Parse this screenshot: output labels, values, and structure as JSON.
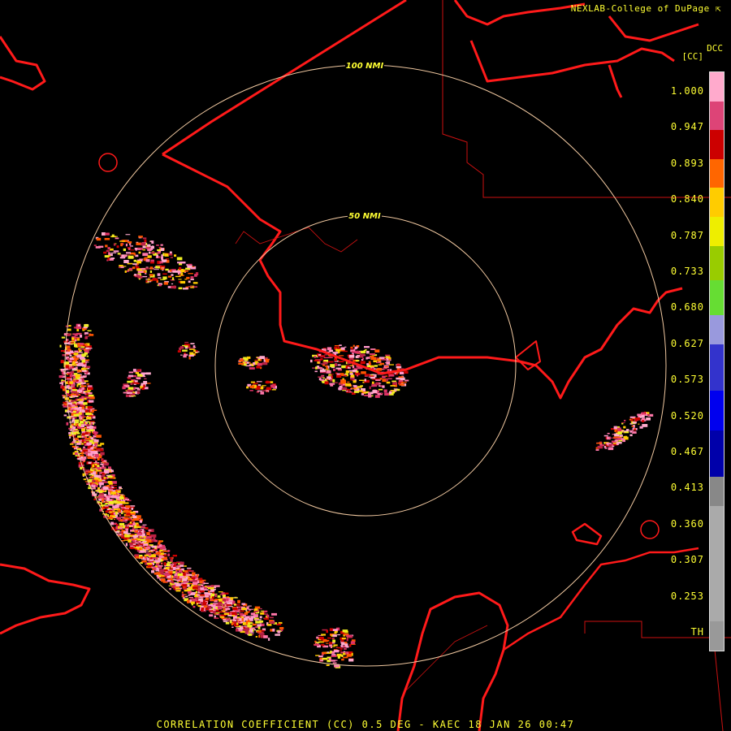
{
  "header": {
    "credit": "NEXLAB-College of DuPage",
    "credit_icon": "nexlab-logo-icon",
    "product_code": "DCC",
    "units": "[CC]"
  },
  "footer": {
    "title": "CORRELATION COEFFICIENT (CC) 0.5 DEG - KAEC 18 JAN 26 00:47"
  },
  "range_rings": [
    {
      "label": "50 NMI"
    },
    {
      "label": "100 NMI"
    }
  ],
  "legend": {
    "labels": [
      "1.000",
      "0.947",
      "0.893",
      "0.840",
      "0.787",
      "0.733",
      "0.680",
      "0.627",
      "0.573",
      "0.520",
      "0.467",
      "0.413",
      "0.360",
      "0.307",
      "0.253",
      "TH"
    ],
    "colors": [
      "#ffaacc",
      "#dd4477",
      "#cc0000",
      "#ff6600",
      "#ffcc00",
      "#eeee00",
      "#99cc00",
      "#66dd33",
      "#9999dd",
      "#3333cc",
      "#0000ee",
      "#0000aa",
      "#888888",
      "#aaaaaa",
      "#999999",
      "#000000"
    ],
    "color_stops": [
      0.0,
      0.05,
      0.1,
      0.15,
      0.2,
      0.25,
      0.3,
      0.36,
      0.42,
      0.47,
      0.55,
      0.62,
      0.7,
      0.75,
      0.95,
      1.0
    ]
  },
  "colors": {
    "coastline": "#ff1a1a",
    "rings": "#f0c8a0",
    "text": "#ffff33"
  }
}
